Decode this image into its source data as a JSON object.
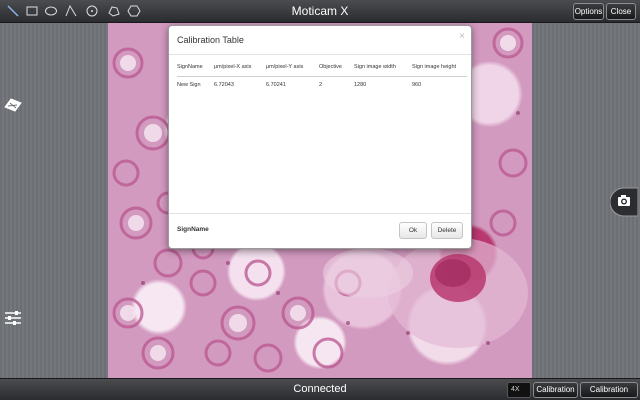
{
  "app": {
    "title": "Moticam X"
  },
  "toolbar": {
    "tools": [
      "pointer-icon",
      "rectangle-icon",
      "ellipse-icon",
      "angle-icon",
      "circle-icon",
      "polygon-icon",
      "hexagon-icon"
    ],
    "options_label": "Options",
    "close_label": "Close"
  },
  "status": {
    "text": "Connected"
  },
  "bottom": {
    "zoom_value": "4X",
    "calibration_label": "Calibration",
    "calibration_table_label": "Calibration Table"
  },
  "dialog": {
    "title": "Calibration Table",
    "close_symbol": "×",
    "columns": [
      "SignName",
      "μm/pixel-X axis",
      "μm/pixel-Y axis",
      "Objective",
      "Sign image width",
      "Sign image height"
    ],
    "rows": [
      [
        "New Sign",
        "6.72043",
        "6.70241",
        "2",
        "1280",
        "960"
      ]
    ],
    "footer_label": "SignName",
    "ok_label": "Ok",
    "delete_label": "Delete"
  },
  "side_icons": [
    "brightness-icon",
    "camera-icon",
    "sliders-icon"
  ],
  "colors": {
    "bar": "#2b2c2f",
    "tissue": "#d39ac0",
    "nuclei": "#b8386f"
  }
}
